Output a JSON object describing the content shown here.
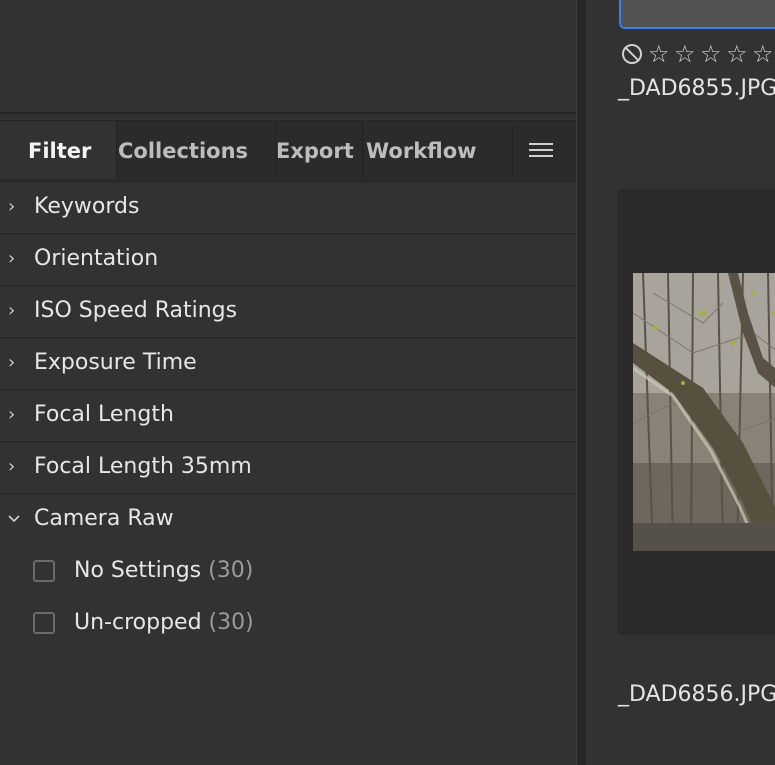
{
  "tabs": [
    {
      "label": "Filter",
      "active": true
    },
    {
      "label": "Collections",
      "active": false
    },
    {
      "label": "Export",
      "active": false
    },
    {
      "label": "Workflow",
      "active": false
    }
  ],
  "menu_icon": "hamburger-menu-icon",
  "filters": [
    {
      "label": "Keywords",
      "expanded": false
    },
    {
      "label": "Orientation",
      "expanded": false
    },
    {
      "label": "ISO Speed Ratings",
      "expanded": false
    },
    {
      "label": "Exposure Time",
      "expanded": false
    },
    {
      "label": "Focal Length",
      "expanded": false
    },
    {
      "label": "Focal Length 35mm",
      "expanded": false
    },
    {
      "label": "Camera Raw",
      "expanded": true
    }
  ],
  "camera_raw_options": [
    {
      "label": "No Settings",
      "count": "(30)",
      "checked": false
    },
    {
      "label": "Un-cropped",
      "count": "(30)",
      "checked": false
    }
  ],
  "content": {
    "items": [
      {
        "filename": "_DAD6855.JPG",
        "rating": 0
      },
      {
        "filename": "_DAD6856.JPG"
      }
    ]
  },
  "colors": {
    "accent": "#3b7ee6",
    "panel": "#323232",
    "tabbar": "#2b2b2b"
  }
}
